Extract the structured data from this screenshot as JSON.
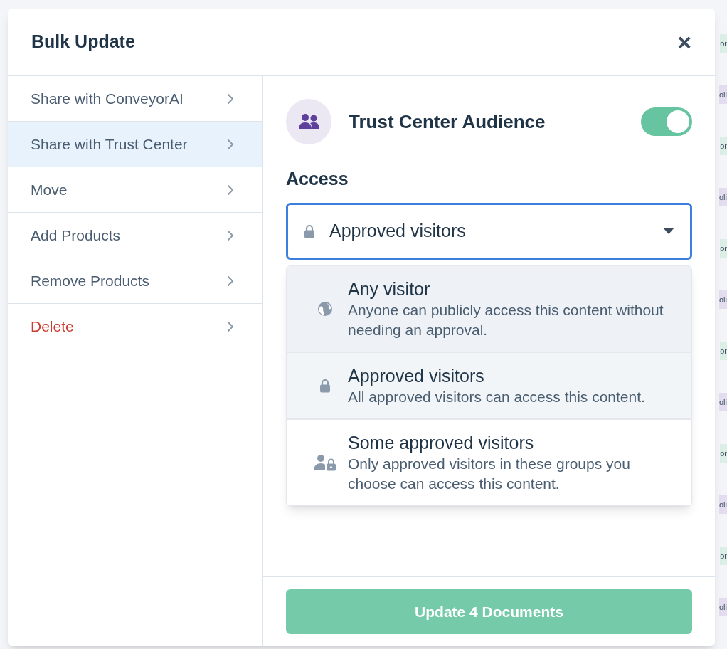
{
  "background": {
    "tags": [
      {
        "text": "or",
        "color": "#dcefe6"
      },
      {
        "text": "oli",
        "color": "#e3ddef"
      },
      {
        "text": "or",
        "color": "#dcefe6"
      },
      {
        "text": "oli",
        "color": "#e3ddef"
      },
      {
        "text": "or",
        "color": "#dcefe6"
      },
      {
        "text": "oli",
        "color": "#e3ddef"
      },
      {
        "text": "or",
        "color": "#dcefe6"
      },
      {
        "text": "oli",
        "color": "#e3ddef"
      },
      {
        "text": "or",
        "color": "#dcefe6"
      },
      {
        "text": "oli",
        "color": "#e3ddef"
      },
      {
        "text": "or",
        "color": "#dcefe6"
      },
      {
        "text": "oli",
        "color": "#e3ddef"
      }
    ]
  },
  "dialog": {
    "title": "Bulk Update",
    "close": "×"
  },
  "sidebar": {
    "items": [
      {
        "label": "Share with ConveyorAI",
        "selected": false,
        "kind": "normal"
      },
      {
        "label": "Share with Trust Center",
        "selected": true,
        "kind": "normal"
      },
      {
        "label": "Move",
        "selected": false,
        "kind": "normal"
      },
      {
        "label": "Add Products",
        "selected": false,
        "kind": "normal"
      },
      {
        "label": "Remove Products",
        "selected": false,
        "kind": "normal"
      },
      {
        "label": "Delete",
        "selected": false,
        "kind": "danger"
      }
    ]
  },
  "panel": {
    "audience": {
      "label": "Trust Center Audience",
      "on": true
    },
    "access": {
      "label": "Access",
      "value": "Approved visitors",
      "expanded": true,
      "options": [
        {
          "kind": "globe",
          "title": "Any visitor",
          "description": "Anyone can publicly access this content without needing an approval.",
          "highlighted": true,
          "selected": false
        },
        {
          "kind": "lock",
          "title": "Approved visitors",
          "description": "All approved visitors can access this content.",
          "highlighted": false,
          "selected": true
        },
        {
          "kind": "user-lock",
          "title": "Some approved visitors",
          "description": "Only approved visitors in these groups you choose can access this content.",
          "highlighted": false,
          "selected": false
        }
      ]
    },
    "submit": {
      "label": "Update 4 Documents",
      "disabled": true
    }
  }
}
